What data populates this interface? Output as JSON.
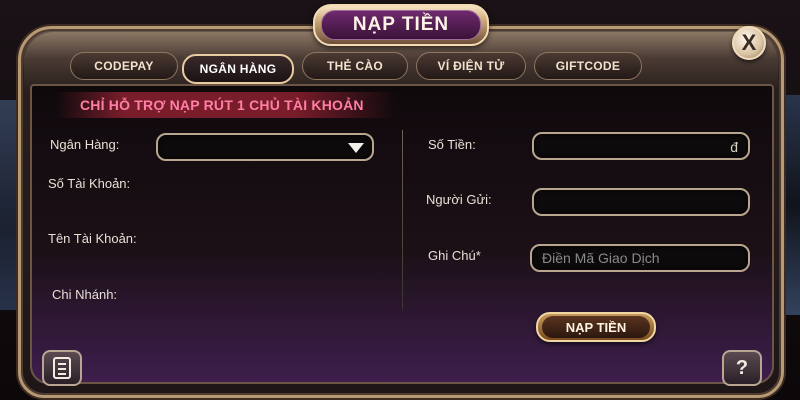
{
  "dialog": {
    "title": "NẠP TIỀN",
    "close_label": "X"
  },
  "tabs": [
    {
      "label": "CODEPAY"
    },
    {
      "label": "NGÂN HÀNG",
      "active": true
    },
    {
      "label": "THẺ CÀO"
    },
    {
      "label": "VÍ ĐIỆN TỬ"
    },
    {
      "label": "GIFTCODE"
    }
  ],
  "notice": "CHỈ HỖ TRỢ NẠP RÚT 1 CHỦ TÀI KHOẢN",
  "left_form": {
    "bank_label": "Ngân Hàng:",
    "bank_value": "",
    "account_number_label": "Số Tài Khoản:",
    "account_name_label": "Tên Tài Khoản:",
    "branch_label": "Chi Nhánh:"
  },
  "right_form": {
    "amount_label": "Số Tiền:",
    "amount_value": "",
    "currency": "đ",
    "sender_label": "Người Gửi:",
    "sender_value": "",
    "note_label": "Ghi Chú*",
    "note_placeholder": "Điền Mã Giao Dịch"
  },
  "submit_label": "NẠP TIỀN",
  "help_label": "?",
  "icons": {
    "close": "close-icon",
    "dropdown": "chevron-down-icon",
    "history": "scroll-history-icon",
    "help": "help-icon"
  },
  "colors": {
    "notice_text": "#ff7fa6",
    "frame_gold": "#b79a74",
    "panel_purple": "#3e1e4d"
  }
}
